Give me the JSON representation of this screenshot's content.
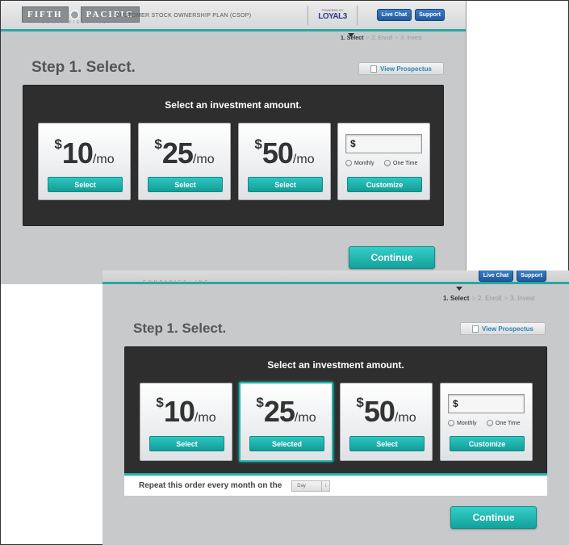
{
  "brand": {
    "logo_left": "FIFTH",
    "logo_right": "PACIFIC",
    "logo_sub": "COMPANIES, INC.",
    "plan_title": "CUSTOMER STOCK OWNERSHIP PLAN (CSOP)",
    "powered_by": "POWERED BY",
    "powered_name": "LOYAL3"
  },
  "header": {
    "live_chat": "Live Chat",
    "support": "Support"
  },
  "steps": {
    "step1": "1. Select",
    "step2": "2. Enroll",
    "step3": "3. Invest",
    "separator": ">"
  },
  "page": {
    "title": "Step 1. Select.",
    "prospectus": "View Prospectus",
    "panel_title": "Select an investment amount.",
    "continue": "Continue"
  },
  "screen1": {
    "cards": [
      {
        "currency": "$",
        "amount": "10",
        "period": "/mo",
        "button": "Select"
      },
      {
        "currency": "$",
        "amount": "25",
        "period": "/mo",
        "button": "Select"
      },
      {
        "currency": "$",
        "amount": "50",
        "period": "/mo",
        "button": "Select"
      }
    ],
    "custom": {
      "value": "$",
      "monthly": "Monthly",
      "one_time": "One Time",
      "button": "Customize"
    }
  },
  "screen2": {
    "cards": [
      {
        "currency": "$",
        "amount": "10",
        "period": "/mo",
        "button": "Select"
      },
      {
        "currency": "$",
        "amount": "25",
        "period": "/mo",
        "button": "Selected"
      },
      {
        "currency": "$",
        "amount": "50",
        "period": "/mo",
        "button": "Select"
      }
    ],
    "custom": {
      "value": "$",
      "monthly": "Monthly",
      "one_time": "One Time",
      "button": "Customize"
    },
    "repeat": {
      "label": "Repeat this order every month on the",
      "select_value": "Day",
      "select_arrow": "↕"
    }
  },
  "colors": {
    "teal": "#1fb3ad",
    "blue": "#2a63ad",
    "panel": "#2e2e2e"
  }
}
